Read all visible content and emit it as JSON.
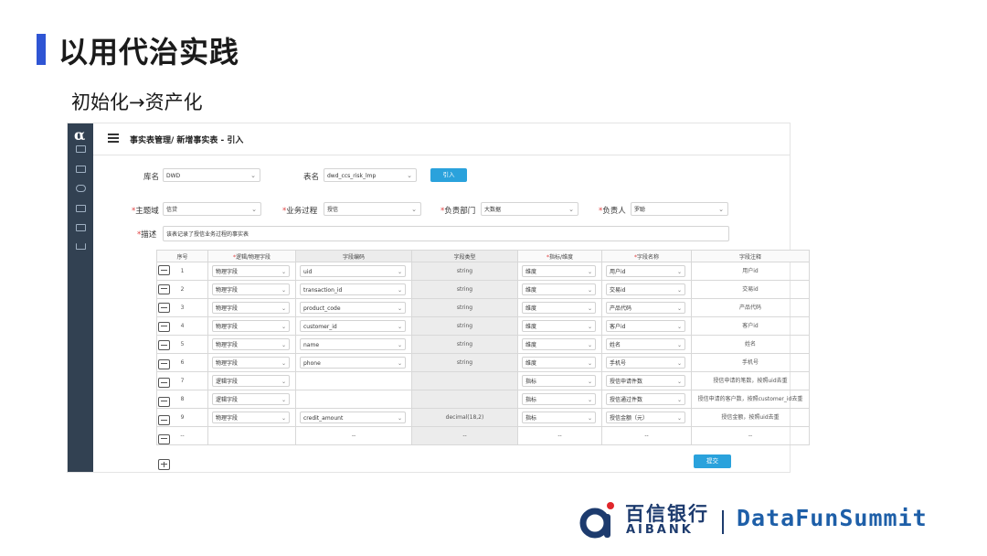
{
  "slide": {
    "title": "以用代治实践",
    "subtitle": "初始化→资产化"
  },
  "app": {
    "logo_glyph": "α",
    "breadcrumb": "事实表管理/ 新增事实表 - 引入",
    "sidebar_icons": [
      "grid-icon",
      "folder-icon",
      "eye-icon",
      "shield-icon",
      "table-icon",
      "chart-icon"
    ]
  },
  "form": {
    "db_label": "库名",
    "db_value": "DWD",
    "table_label": "表名",
    "table_value": "dwd_ccs_risk_lmp",
    "import_button": "引入",
    "subject_label": "*主题域",
    "subject_value": "信贷",
    "process_label": "*业务过程",
    "process_value": "授信",
    "dept_label": "*负责部门",
    "dept_value": "大数据",
    "owner_label": "*负责人",
    "owner_value": "罗聪",
    "desc_label": "*描述",
    "desc_value": "该表记录了授信业务过程的事实表"
  },
  "grid": {
    "headers": [
      "序号",
      "*逻辑/物理字段",
      "字段编码",
      "字段类型",
      "*指标/维度",
      "*字段名称",
      "字段注释"
    ],
    "rows": [
      {
        "no": "1",
        "kind": "物理字段",
        "code": "uid",
        "type": "string",
        "dim": "维度",
        "name": "用户id",
        "comment": "用户id"
      },
      {
        "no": "2",
        "kind": "物理字段",
        "code": "transaction_id",
        "type": "string",
        "dim": "维度",
        "name": "交易id",
        "comment": "交易id"
      },
      {
        "no": "3",
        "kind": "物理字段",
        "code": "product_code",
        "type": "string",
        "dim": "维度",
        "name": "产品代码",
        "comment": "产品代码"
      },
      {
        "no": "4",
        "kind": "物理字段",
        "code": "customer_id",
        "type": "string",
        "dim": "维度",
        "name": "客户id",
        "comment": "客户id"
      },
      {
        "no": "5",
        "kind": "物理字段",
        "code": "name",
        "type": "string",
        "dim": "维度",
        "name": "姓名",
        "comment": "姓名"
      },
      {
        "no": "6",
        "kind": "物理字段",
        "code": "phone",
        "type": "string",
        "dim": "维度",
        "name": "手机号",
        "comment": "手机号"
      },
      {
        "no": "7",
        "kind": "逻辑字段",
        "code": "",
        "type": "",
        "dim": "指标",
        "name": "授信申请件数",
        "comment": "授信申请的笔数，按照uid去重"
      },
      {
        "no": "8",
        "kind": "逻辑字段",
        "code": "",
        "type": "",
        "dim": "指标",
        "name": "授信通过件数",
        "comment": "授信申请的客户数，按照customer_id去重"
      },
      {
        "no": "9",
        "kind": "物理字段",
        "code": "credit_amount",
        "type": "decimal(18,2)",
        "dim": "指标",
        "name": "授信金额（元）",
        "comment": "授信金额，按照uid去重"
      },
      {
        "no": "--",
        "kind": "",
        "code": "--",
        "type": "--",
        "dim": "--",
        "name": "--",
        "comment": "--"
      }
    ],
    "submit_button": "提交"
  },
  "brand": {
    "bank_cn": "百信银行",
    "bank_en": "AIBANK",
    "summit": "DataFunSummit",
    "colors": {
      "navy": "#1d3b6e",
      "blue": "#1e5fa8",
      "red": "#e0262b"
    }
  }
}
